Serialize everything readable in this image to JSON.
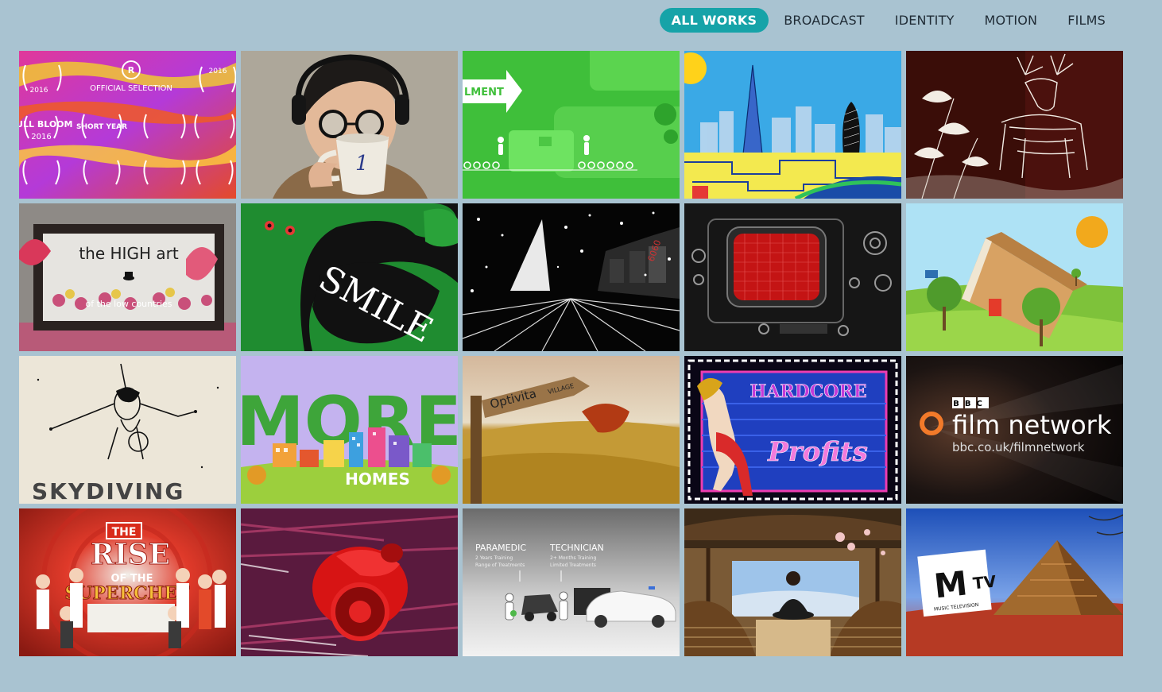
{
  "nav": {
    "items": [
      {
        "label": "ALL WORKS",
        "active": true
      },
      {
        "label": "BROADCAST",
        "active": false
      },
      {
        "label": "IDENTITY",
        "active": false
      },
      {
        "label": "MOTION",
        "active": false
      },
      {
        "label": "FILMS",
        "active": false
      }
    ]
  },
  "colors": {
    "background": "#a9c3d1",
    "accent": "#16a3a8"
  },
  "tiles": [
    {
      "texts": [
        "OFFICIAL SELECTION",
        "FULL BLOOM",
        "2016",
        "SHORT YEAR",
        "2016",
        "2016"
      ]
    },
    {
      "texts": [
        "1"
      ]
    },
    {
      "texts": [
        "LMENT"
      ]
    },
    {
      "texts": []
    },
    {
      "texts": []
    },
    {
      "texts": [
        "the HIGH art",
        "of the low countries"
      ]
    },
    {
      "texts": [
        "SMILE"
      ]
    },
    {
      "texts": []
    },
    {
      "texts": []
    },
    {
      "texts": []
    },
    {
      "texts": [
        "SKYDIVING"
      ]
    },
    {
      "texts": [
        "MORE",
        "HOMES"
      ]
    },
    {
      "texts": [
        "Optivita",
        "VILLAGE"
      ]
    },
    {
      "texts": [
        "HARDCORE",
        "Profits"
      ]
    },
    {
      "texts": [
        "BBC",
        "film network",
        "bbc.co.uk/filmnetwork"
      ]
    },
    {
      "texts": [
        "THE",
        "RISE",
        "OF THE",
        "SUPERCHEF"
      ]
    },
    {
      "texts": []
    },
    {
      "texts": [
        "PARAMEDIC",
        "2 Years Training",
        "Range of Treatments",
        "TECHNICIAN",
        "2+ Months Training",
        "Limited Treatments"
      ]
    },
    {
      "texts": []
    },
    {
      "texts": [
        "MUSIC TELEVISION"
      ]
    }
  ]
}
